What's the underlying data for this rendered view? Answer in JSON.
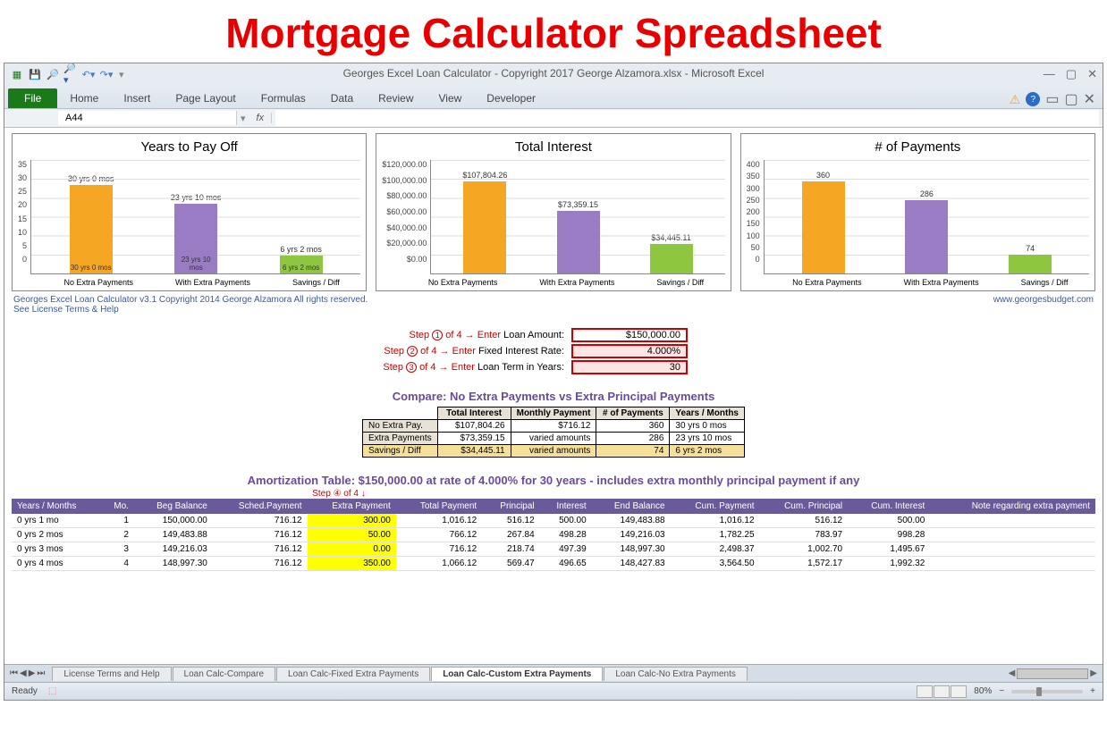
{
  "banner": "Mortgage Calculator Spreadsheet",
  "window_title": "Georges Excel Loan Calculator -  Copyright 2017 George Alzamora.xlsx  -  Microsoft Excel",
  "ribbon": {
    "file": "File",
    "home": "Home",
    "insert": "Insert",
    "page_layout": "Page Layout",
    "formulas": "Formulas",
    "data": "Data",
    "review": "Review",
    "view": "View",
    "developer": "Developer"
  },
  "namebox": "A44",
  "copyright_left_1": "Georges Excel Loan Calculator v3.1    Copyright 2014  George Alzamora  All rights reserved.",
  "copyright_left_2": "See License Terms & Help",
  "copyright_right": "www.georgesbudget.com",
  "steps": {
    "s1_prefix": "Step ",
    "s1_num": "1",
    "s1_mid": " of 4 → ",
    "s1_action": "Enter ",
    "s1_label": "Loan Amount:",
    "s1_value": "$150,000.00",
    "s2_num": "2",
    "s2_label": "Fixed Interest Rate:",
    "s2_value": "4.000%",
    "s3_num": "3",
    "s3_label": "Loan Term in Years:",
    "s3_value": "30",
    "s4": "Step ④ of 4 ↓"
  },
  "compare": {
    "title": "Compare: No Extra Payments vs Extra Principal Payments",
    "headers": [
      "",
      "Total Interest",
      "Monthly Payment",
      "# of Payments",
      "Years / Months"
    ],
    "rows": [
      {
        "label": "No Extra Pay.",
        "ti": "$107,804.26",
        "mp": "$716.12",
        "np": "360",
        "ym": "30 yrs 0 mos"
      },
      {
        "label": "Extra Payments",
        "ti": "$73,359.15",
        "mp": "varied amounts",
        "np": "286",
        "ym": "23 yrs 10 mos"
      },
      {
        "label": "Savings / Diff",
        "ti": "$34,445.11",
        "mp": "varied amounts",
        "np": "74",
        "ym": "6 yrs 2 mos"
      }
    ]
  },
  "amort_title": "Amortization Table:  $150,000.00 at rate of 4.000% for 30 years - includes extra monthly principal payment if any",
  "amort": {
    "headers": [
      "Years / Months",
      "Mo.",
      "Beg Balance",
      "Sched.Payment",
      "Extra Payment",
      "Total Payment",
      "Principal",
      "Interest",
      "End Balance",
      "Cum. Payment",
      "Cum. Principal",
      "Cum. Interest",
      "Note regarding extra payment"
    ],
    "rows": [
      [
        "0 yrs 1 mo",
        "1",
        "150,000.00",
        "716.12",
        "300.00",
        "1,016.12",
        "516.12",
        "500.00",
        "149,483.88",
        "1,016.12",
        "516.12",
        "500.00",
        ""
      ],
      [
        "0 yrs 2 mos",
        "2",
        "149,483.88",
        "716.12",
        "50.00",
        "766.12",
        "267.84",
        "498.28",
        "149,216.03",
        "1,782.25",
        "783.97",
        "998.28",
        ""
      ],
      [
        "0 yrs 3 mos",
        "3",
        "149,216.03",
        "716.12",
        "0.00",
        "716.12",
        "218.74",
        "497.39",
        "148,997.30",
        "2,498.37",
        "1,002.70",
        "1,495.67",
        ""
      ],
      [
        "0 yrs 4 mos",
        "4",
        "148,997.30",
        "716.12",
        "350.00",
        "1,066.12",
        "569.47",
        "496.65",
        "148,427.83",
        "3,564.50",
        "1,572.17",
        "1,992.32",
        ""
      ]
    ]
  },
  "sheet_tabs": [
    "License Terms and Help",
    "Loan Calc-Compare",
    "Loan Calc-Fixed Extra Payments",
    "Loan Calc-Custom Extra Payments",
    "Loan Calc-No Extra Payments"
  ],
  "active_tab": 3,
  "status": {
    "ready": "Ready",
    "zoom": "80%"
  },
  "chart_data": [
    {
      "type": "bar",
      "title": "Years to Pay Off",
      "categories": [
        "No Extra Payments",
        "With Extra Payments",
        "Savings / Diff"
      ],
      "values": [
        30,
        23.83,
        6.17
      ],
      "data_labels": [
        "30 yrs 0 mos",
        "23 yrs 10 mos",
        "6 yrs 2 mos"
      ],
      "ylim": [
        0,
        35
      ],
      "yticks": [
        "0",
        "5",
        "10",
        "15",
        "20",
        "25",
        "30",
        "35"
      ]
    },
    {
      "type": "bar",
      "title": "Total Interest",
      "categories": [
        "No Extra Payments",
        "With Extra Payments",
        "Savings / Diff"
      ],
      "values": [
        107804.26,
        73359.15,
        34445.11
      ],
      "data_labels": [
        "$107,804.26",
        "$73,359.15",
        "$34,445.11"
      ],
      "ylim": [
        0,
        120000
      ],
      "yticks": [
        "$0.00",
        "$20,000.00",
        "$40,000.00",
        "$60,000.00",
        "$80,000.00",
        "$100,000.00",
        "$120,000.00"
      ]
    },
    {
      "type": "bar",
      "title": "# of Payments",
      "categories": [
        "No Extra Payments",
        "With Extra Payments",
        "Savings / Diff"
      ],
      "values": [
        360,
        286,
        74
      ],
      "data_labels": [
        "360",
        "286",
        "74"
      ],
      "ylim": [
        0,
        400
      ],
      "yticks": [
        "0",
        "50",
        "100",
        "150",
        "200",
        "250",
        "300",
        "350",
        "400"
      ]
    }
  ]
}
